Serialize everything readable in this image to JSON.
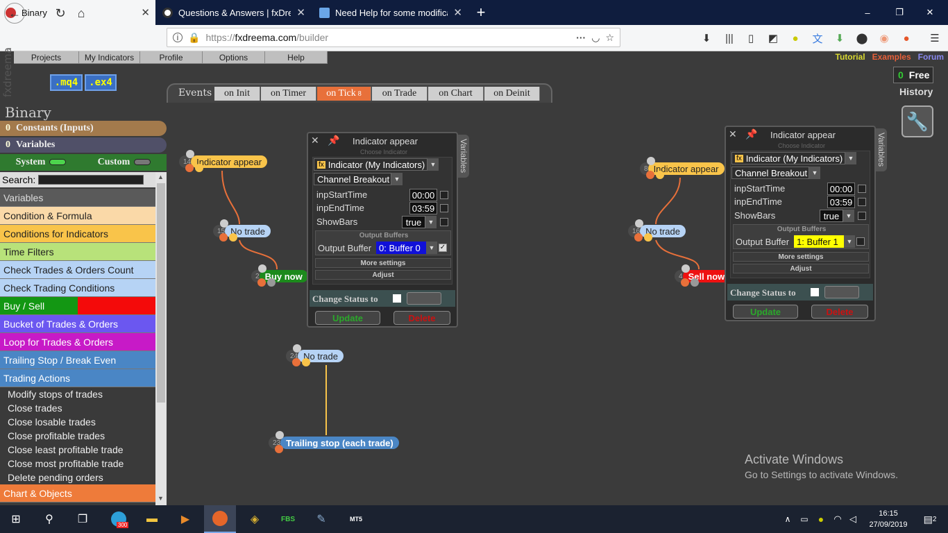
{
  "browser": {
    "tabs": [
      {
        "title": "Binary"
      },
      {
        "title": "Questions & Answers | fxDreema"
      },
      {
        "title": "Need Help for some modification"
      }
    ],
    "new_tab": "+",
    "url": "https://fxdreema.com/builder",
    "url_prefix": "https://",
    "url_host": "fxdreema.com",
    "url_path": "/builder",
    "window_controls": [
      "–",
      "❐",
      "✕"
    ]
  },
  "app": {
    "vertical_title": "fxdreema",
    "menu": [
      "Projects",
      "My Indicators",
      "Profile",
      "Options",
      "Help"
    ],
    "formats": [
      ".mq4",
      ".ex4"
    ],
    "toplinks": [
      {
        "label": "Tutorial",
        "color": "#d8d830"
      },
      {
        "label": "Examples",
        "color": "#e8603a"
      },
      {
        "label": "Forum",
        "color": "#8888ee"
      }
    ],
    "free": {
      "count": "0",
      "label": "Free"
    },
    "history": "History",
    "events": {
      "label": "Events",
      "tabs": [
        {
          "label": "on Init"
        },
        {
          "label": "on Timer"
        },
        {
          "label": "on Tick",
          "badge": "8",
          "selected": true
        },
        {
          "label": "on Trade"
        },
        {
          "label": "on Chart"
        },
        {
          "label": "on Deinit"
        }
      ]
    }
  },
  "sidebar": {
    "title": "Binary",
    "constants": {
      "count": "0",
      "label": "Constants (Inputs)"
    },
    "variables": {
      "count": "0",
      "label": "Variables"
    },
    "system": "System",
    "custom": "Custom",
    "search_label": "Search:",
    "categories": [
      {
        "label": "Variables",
        "bg": "#5a5a5a",
        "fg": "#ddd"
      },
      {
        "label": "Condition & Formula",
        "bg": "#fad9a8",
        "fg": "#222"
      },
      {
        "label": "Conditions for Indicators",
        "bg": "#f9c44a",
        "fg": "#222"
      },
      {
        "label": "Time Filters",
        "bg": "#b8e27a",
        "fg": "#222"
      },
      {
        "label": "Check Trades & Orders Count",
        "bg": "#b6d3f5",
        "fg": "#222"
      },
      {
        "label": "Check Trading Conditions",
        "bg": "#b6d3f5",
        "fg": "#222"
      },
      {
        "label": "Buy / Sell",
        "bg": "split",
        "fg": "#fff"
      },
      {
        "label": "Bucket of Trades & Orders",
        "bg": "#6b57f0",
        "fg": "#fff"
      },
      {
        "label": "Loop for Trades & Orders",
        "bg": "#c71ac7",
        "fg": "#fff"
      },
      {
        "label": "Trailing Stop / Break Even",
        "bg": "#4a86c5",
        "fg": "#fff"
      },
      {
        "label": "Trading Actions",
        "bg": "#4a86c5",
        "fg": "#fff"
      }
    ],
    "subitems": [
      "Modify stops of trades",
      "Close trades",
      "Close losable trades",
      "Close profitable trades",
      "Close least profitable trade",
      "Close most profitable trade",
      "Delete pending orders"
    ],
    "last_category": {
      "label": "Chart & Objects",
      "bg": "#ee7b3a",
      "fg": "#fff"
    }
  },
  "nodes": [
    {
      "id": "14",
      "label": "Indicator appear",
      "bg": "#f9c44a",
      "fg": "#222"
    },
    {
      "id": "15",
      "label": "No trade",
      "bg": "#b6d3f5",
      "fg": "#222"
    },
    {
      "id": "2",
      "label": "Buy now",
      "bg": "#1c8a1c",
      "fg": "#fff"
    },
    {
      "id": "24",
      "label": "No trade",
      "bg": "#b6d3f5",
      "fg": "#222"
    },
    {
      "id": "23",
      "label": "Trailing stop (each trade)",
      "bg": "#4a86c5",
      "fg": "#fff"
    },
    {
      "id": "8",
      "label": "Indicator appear",
      "bg": "#f9c44a",
      "fg": "#222"
    },
    {
      "id": "16",
      "label": "No trade",
      "bg": "#b6d3f5",
      "fg": "#222"
    },
    {
      "id": "4",
      "label": "Sell now",
      "bg": "#ee1111",
      "fg": "#fff"
    }
  ],
  "panels": [
    {
      "title": "Indicator appear",
      "sub": "Choose Indicator",
      "indicator": "Indicator (My Indicators)",
      "name": "Channel Breakout",
      "params": [
        {
          "label": "inpStartTime",
          "value": "00:00"
        },
        {
          "label": "inpEndTime",
          "value": "03:59"
        },
        {
          "label": "ShowBars",
          "value": "true"
        }
      ],
      "output_title": "Output Buffers",
      "output_label": "Output Buffer",
      "output_value": "0: Buffer 0",
      "output_bg": "#1010d8",
      "output_fg": "#fff",
      "more": "More settings",
      "adjust": "Adjust",
      "status_label": "Change Status to",
      "update": "Update",
      "delete": "Delete",
      "vtab": "Variables"
    },
    {
      "title": "Indicator appear",
      "sub": "Choose Indicator",
      "indicator": "Indicator (My Indicators)",
      "name": "Channel Breakout",
      "params": [
        {
          "label": "inpStartTime",
          "value": "00:00"
        },
        {
          "label": "inpEndTime",
          "value": "03:59"
        },
        {
          "label": "ShowBars",
          "value": "true"
        }
      ],
      "output_title": "Output Buffers",
      "output_label": "Output Buffer",
      "output_value": "1: Buffer 1",
      "output_bg": "#ffff00",
      "output_fg": "#111",
      "more": "More settings",
      "adjust": "Adjust",
      "status_label": "Change Status to",
      "update": "Update",
      "delete": "Delete",
      "vtab": "Variables"
    }
  ],
  "watermark": {
    "line1": "Activate Windows",
    "line2": "Go to Settings to activate Windows."
  },
  "taskbar": {
    "badge": "300",
    "time": "16:15",
    "date": "27/09/2019",
    "notif": "2"
  }
}
